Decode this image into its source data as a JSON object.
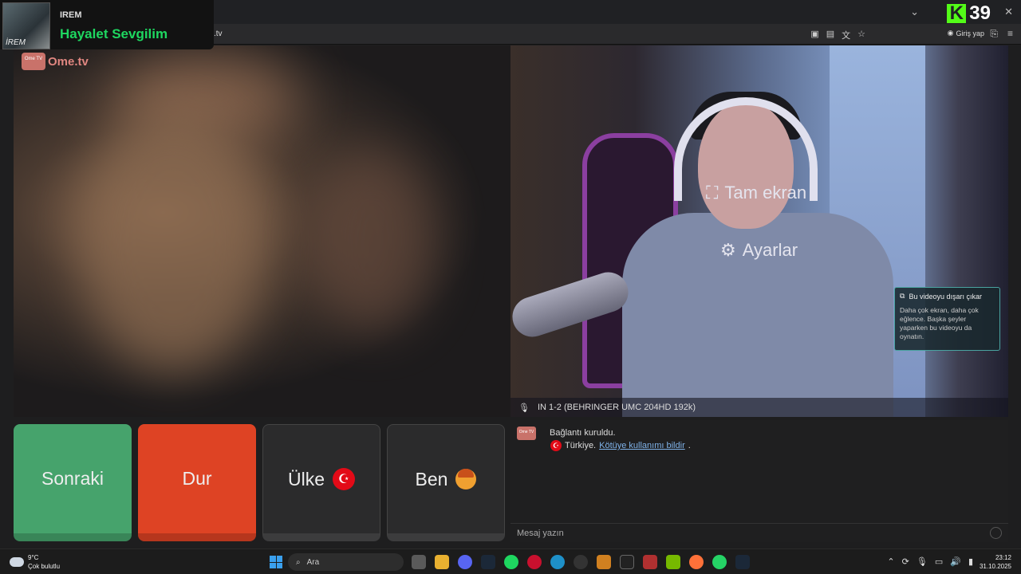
{
  "now_playing": {
    "artist": "IREM",
    "song": "Hayalet Sevgilim",
    "album_text": "İREM"
  },
  "browser": {
    "url": ".tv",
    "login_label": "Giriş yap"
  },
  "kick": {
    "count": "39"
  },
  "site": {
    "logo_box": "Ome TV",
    "logo_text": "Ome.tv"
  },
  "video_menu": {
    "fullscreen": "Tam ekran",
    "settings": "Ayarlar"
  },
  "tooltip": {
    "title": "Bu videoyu dışarı çıkar",
    "body": "Daha çok ekran, daha çok eğlence. Başka şeyler yaparken bu videoyu da oynatın."
  },
  "audio_device": "IN 1-2 (BEHRINGER UMC 204HD 192k)",
  "buttons": {
    "next": "Sonraki",
    "stop": "Dur",
    "country": "Ülke",
    "me": "Ben"
  },
  "chat": {
    "line1": "Bağlantı kuruldu.",
    "country": "Türkiye.",
    "report_link": "Kötüye kullanımı bildir",
    "period": ".",
    "input_placeholder": "Mesaj yazın"
  },
  "taskbar": {
    "temp": "9°C",
    "weather": "Çok bulutlu",
    "search_label": "Ara",
    "time": "23:12",
    "date": "31.10.2025"
  },
  "colors": {
    "next": "#46a36c",
    "stop": "#de4324",
    "kick": "#53fc18",
    "spotify_green": "#1ed760"
  }
}
